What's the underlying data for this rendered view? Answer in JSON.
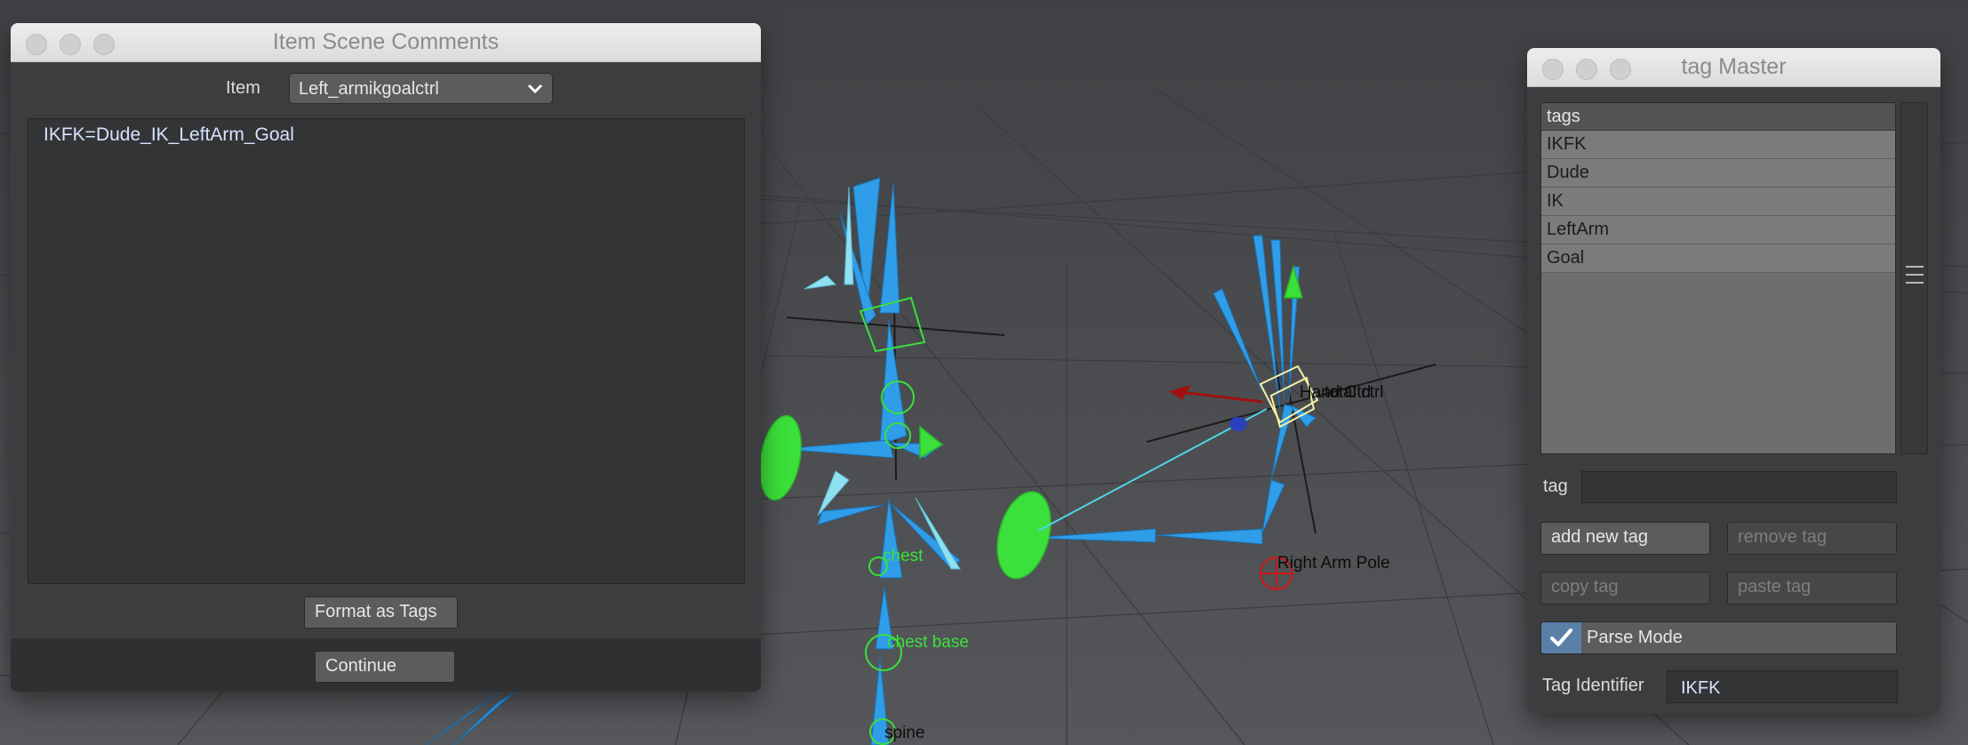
{
  "viewport": {
    "labels": {
      "chest": "chest",
      "chest_base": "chest base",
      "spine": "spine",
      "hand_ctrl": "Hand Ctrl",
      "total_ctrl": "total ctrl",
      "right_arm_pole": "Right Arm Pole"
    }
  },
  "comments_window": {
    "title": "Item Scene Comments",
    "item_label": "Item",
    "item_value": "Left_armikgoalctrl",
    "comment_text": "IKFK=Dude_IK_LeftArm_Goal",
    "format_button": "Format as Tags",
    "continue_button": "Continue"
  },
  "tag_window": {
    "title": "tag Master",
    "list_header": "tags",
    "tags": [
      "IKFK",
      "Dude",
      "IK",
      "LeftArm",
      "Goal"
    ],
    "tag_label": "tag",
    "tag_value": "",
    "add_button": "add new tag",
    "remove_button": "remove tag",
    "copy_button": "copy tag",
    "paste_button": "paste tag",
    "parse_mode_label": "Parse Mode",
    "parse_mode_checked": true,
    "tag_identifier_label": "Tag Identifier",
    "tag_identifier_value": "IKFK"
  },
  "colors": {
    "viewport_bg": "#4a4c4f",
    "bone_blue": "#2f9de8",
    "control_green": "#3be03b",
    "accent_blue": "#5b80a8"
  }
}
